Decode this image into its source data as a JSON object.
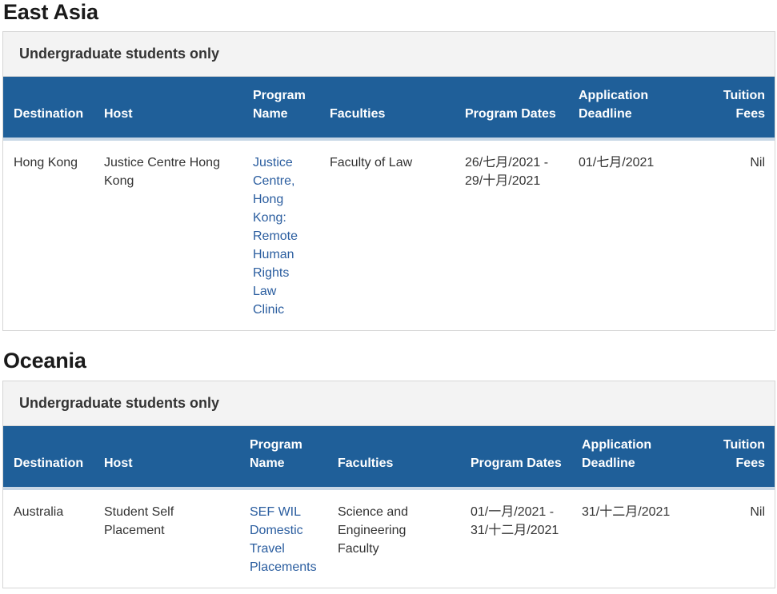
{
  "regions": [
    {
      "title": "East Asia",
      "scope": "Undergraduate students only",
      "headers": {
        "destination": "Destination",
        "host": "Host",
        "program_name": "Program Name",
        "faculties": "Faculties",
        "program_dates": "Program Dates",
        "application_deadline": "Application Deadline",
        "tuition_fees": "Tuition Fees"
      },
      "rows": [
        {
          "destination": "Hong Kong",
          "host": "Justice Centre Hong Kong",
          "program_name": "Justice Centre, Hong Kong: Remote Human Rights Law Clinic",
          "faculties": "Faculty of Law",
          "program_dates": "26/七月/2021 - 29/十月/2021",
          "application_deadline": "01/七月/2021",
          "tuition_fees": "Nil"
        }
      ]
    },
    {
      "title": "Oceania",
      "scope": "Undergraduate students only",
      "headers": {
        "destination": "Destination",
        "host": "Host",
        "program_name": "Program Name",
        "faculties": "Faculties",
        "program_dates": "Program Dates",
        "application_deadline": "Application Deadline",
        "tuition_fees": "Tuition Fees"
      },
      "rows": [
        {
          "destination": "Australia",
          "host": "Student Self Placement",
          "program_name": "SEF WIL Domestic Travel Placements",
          "faculties": "Science and Engineering Faculty",
          "program_dates": "01/一月/2021 - 31/十二月/2021",
          "application_deadline": "31/十二月/2021",
          "tuition_fees": "Nil"
        }
      ]
    }
  ],
  "colors": {
    "header_bg": "#1f5f99",
    "link": "#2a5d9f",
    "scope_bg": "#f3f3f3"
  }
}
